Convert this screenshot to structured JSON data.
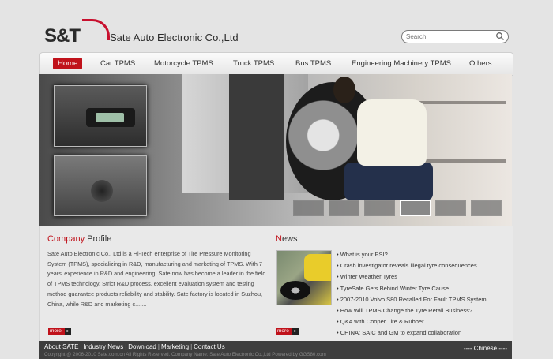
{
  "header": {
    "logo_text": "S&T",
    "company_name": "Sate Auto Electronic Co.,Ltd",
    "search_placeholder": "Search"
  },
  "nav": [
    {
      "label": "Home",
      "active": true
    },
    {
      "label": "Car TPMS"
    },
    {
      "label": "Motorcycle TPMS"
    },
    {
      "label": "Truck TPMS"
    },
    {
      "label": "Bus TPMS"
    },
    {
      "label": "Engineering Machinery TPMS"
    },
    {
      "label": "Others"
    }
  ],
  "banner": {
    "thumbnails": 6,
    "active_thumbnail": 4
  },
  "profile": {
    "heading_first": "Company",
    "heading_rest": " Profile",
    "text": "Sate Auto Electronic Co., Ltd is a Hi-Tech enterprise of Tire Pressure Monitoring System (TPMS), specializing in R&D, manufacturing and marketing of TPMS. With 7 years' experience in R&D and engineering, Sate now has become a leader in the field of TPMS technology. Strict R&D process, excellent evaluation system and testing method guarantee products reliability and stability. Sate factory is located in Suzhou, China, while R&D and marketing c.......",
    "more": "more"
  },
  "news": {
    "heading_first": "N",
    "heading_rest": "ews",
    "more": "more",
    "items": [
      "What is your PSI?",
      "Crash investigator reveals illegal tyre consequences",
      "Winter Weather Tyres",
      "TyreSafe Gets Behind Winter Tyre Cause",
      "2007-2010 Volvo S80 Recalled For Fault TPMS System",
      "How Will TPMS Change the Tyre Retail Business?",
      "Q&A with Cooper Tire & Rubber",
      "CHINA: SAIC and GM to expand collaboration"
    ]
  },
  "footer": {
    "links": [
      "About SATE",
      "Industry News",
      "Download",
      "Marketing",
      "Contact Us"
    ],
    "copyright": "Copyright @ 2006-2010 Sate.com.cn All Rights Reserved. Company Name: Sate Auto Electronic Co.,Ltd Powered by GGS80.com",
    "language": "---- Chinese ----"
  },
  "colors": {
    "accent": "#c0121b",
    "footer_bg": "#3e3e3e",
    "page_bg": "#e4e4e4"
  }
}
